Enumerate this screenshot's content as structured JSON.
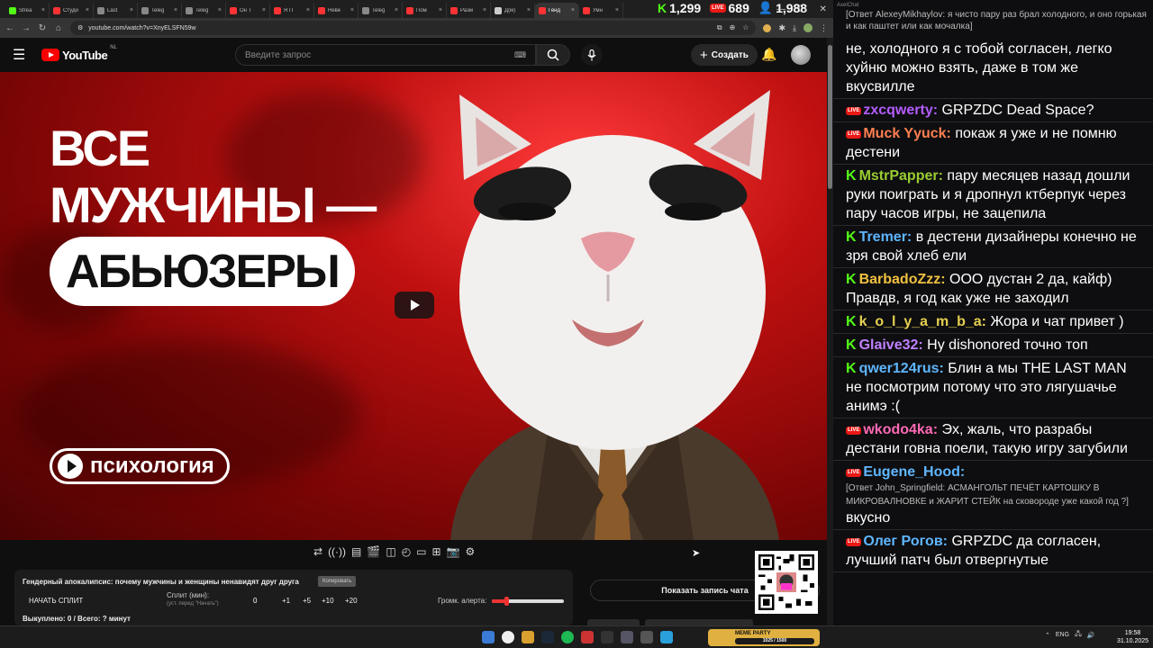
{
  "browser": {
    "tabs": [
      {
        "title": "Strea",
        "color": "#53fc18"
      },
      {
        "title": "Студи",
        "color": "#ff3333"
      },
      {
        "title": "Last",
        "color": "#888888"
      },
      {
        "title": "Teleg",
        "color": "#888888"
      },
      {
        "title": "Teleg",
        "color": "#888888"
      },
      {
        "title": "Он Т",
        "color": "#ff3333"
      },
      {
        "title": "Я П",
        "color": "#ff3333"
      },
      {
        "title": "Неве",
        "color": "#ff3333"
      },
      {
        "title": "Teleg",
        "color": "#888888"
      },
      {
        "title": "Пом",
        "color": "#ff3333"
      },
      {
        "title": "Разм",
        "color": "#ff3333"
      },
      {
        "title": "Д(м)",
        "color": "#cccccc"
      },
      {
        "title": "Генд",
        "color": "#ff3333",
        "active": true
      },
      {
        "title": "Умн",
        "color": "#ff3333"
      }
    ],
    "url": "youtube.com/watch?v=XnyELSFN59w"
  },
  "stream_stats": {
    "kick_viewers": "1,299",
    "twitch_viewers": "689",
    "total_viewers": "1,988",
    "live_badge": "LIVE"
  },
  "youtube": {
    "logo_text": "YouTube",
    "country_code": "NL",
    "search_placeholder": "Введите запрос",
    "create_label": "Создать",
    "thumbnail": {
      "line1": "ВСЕ",
      "line2": "МУЖЧИНЫ —",
      "pill": "АБЬЮЗЕРЫ",
      "category": "психология"
    }
  },
  "split_panel": {
    "title": "Гендерный апокалипсис: почему мужчины и женщины ненавидят друг друга",
    "copy_label": "Копировать",
    "start_label": "НАЧАТЬ СПЛИТ",
    "split_label": "Сплит (мин):",
    "split_hint": "(уст. перед \"Начать\")",
    "split_value": "0",
    "increments": [
      "+1",
      "+5",
      "+10",
      "+20"
    ],
    "alert_label": "Громк. алерта:",
    "alert_volume": 0.2,
    "bought": "Выкуплено: 0 / Всего: ? минут"
  },
  "chat_replay_label": "Показать запись чата",
  "chat": {
    "title": "AxelChat",
    "top_message": "[Ответ AlexeyMikhaylov: я чисто пару раз брал холодного, и оно горькая и как паштет или как мочалка]",
    "messages": [
      {
        "platform": "",
        "user": "",
        "color": "#ffffff",
        "text": "не, холодного я с тобой согласен, легко хуйню можно взять, даже в том же вкусвилле"
      },
      {
        "platform": "live",
        "user": "zxcqwerty:",
        "color": "#b45cff",
        "text": "GRPZDC Dead Space?",
        "bold_text": true
      },
      {
        "platform": "live",
        "user": "Muck Yyuck:",
        "color": "#ff7f50",
        "text": "покаж я уже и не помню дестени"
      },
      {
        "platform": "kick",
        "user": "MstrPapper:",
        "color": "#9acd32",
        "text": "пару месяцев назад дошли руки поиграть и я дропнул ктберпук через пару часов игры, не зацепила"
      },
      {
        "platform": "kick",
        "user": "Tremer:",
        "color": "#5fb6ff",
        "text": "в дестени дизайнеры конечно не зря свой хлеб ели"
      },
      {
        "platform": "kick",
        "user": "BarbadoZzz:",
        "color": "#f0c040",
        "text": "ООО дустан 2 да, кайф) Правдв, я год как уже не заходил"
      },
      {
        "platform": "kick",
        "user": "k_o_l_y_a_m_b_a:",
        "color": "#e6d050",
        "text": "Жора и чат привет )"
      },
      {
        "platform": "kick",
        "user": "Glaive32:",
        "color": "#c080ff",
        "text": "Ну dishonored точно топ"
      },
      {
        "platform": "kick",
        "user": "qwer124rus:",
        "color": "#5fb6ff",
        "text": "Блин а мы THE LAST MAN не посмотрим потому что это лягушачье анимэ :("
      },
      {
        "platform": "live",
        "user": "wkodo4ka:",
        "color": "#ff69b4",
        "text": "Эх, жаль, что разрабы дестани говна поели, такую игру загубили"
      },
      {
        "platform": "live",
        "user": "Eugene_Hood:",
        "color": "#5fb6ff",
        "reply": "[Ответ John_Springfield: АСМАНГОЛЬТ ПЕЧЁТ КАРТОШКУ В МИКРОВАЛНОВКЕ и ЖАРИТ СТЕЙК на сковороде уже какой год ?]",
        "text": "вкусно"
      },
      {
        "platform": "live",
        "user": "Олег Рогов:",
        "color": "#5fb6ff",
        "text": "GRPZDC да согласен, лучший патч был отвергнутые"
      }
    ]
  },
  "taskbar": {
    "widget_title": "MEME PARTY",
    "widget_progress": "1025 / 1500",
    "lang": "ENG",
    "time": "19:58",
    "date": "31.10.2025"
  }
}
